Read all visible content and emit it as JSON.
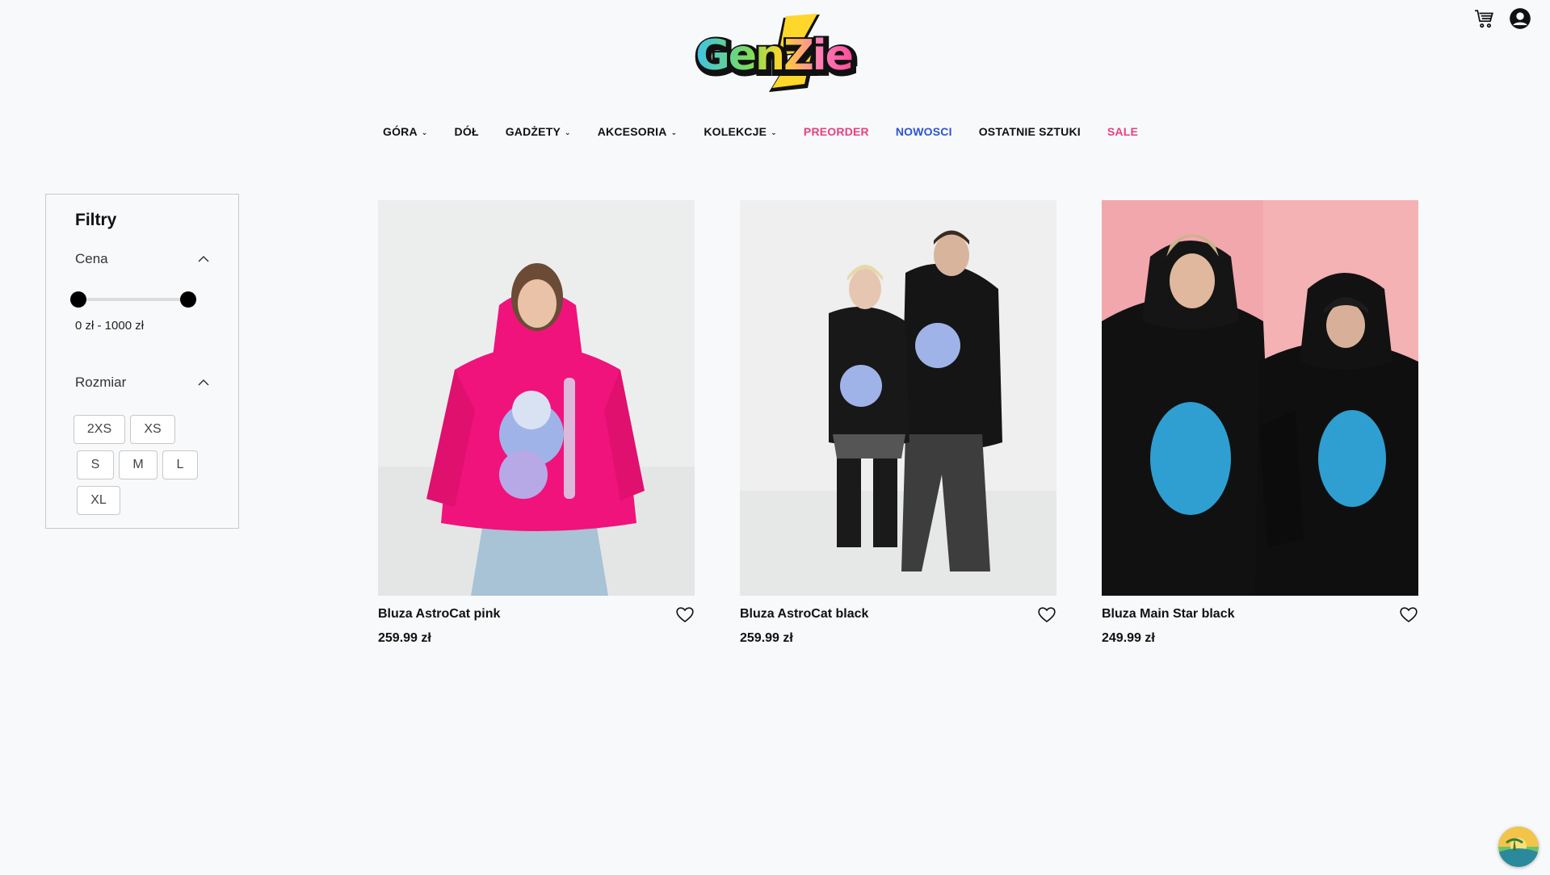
{
  "brand": {
    "logo_text": "GenZie"
  },
  "nav": [
    {
      "label": "GÓRA",
      "dropdown": true,
      "style": "default"
    },
    {
      "label": "DÓŁ",
      "dropdown": false,
      "style": "default"
    },
    {
      "label": "GADŻETY",
      "dropdown": true,
      "style": "default"
    },
    {
      "label": "AKCESORIA",
      "dropdown": true,
      "style": "default"
    },
    {
      "label": "KOLEKCJE",
      "dropdown": true,
      "style": "default"
    },
    {
      "label": "PREORDER",
      "dropdown": false,
      "style": "pink"
    },
    {
      "label": "NOWOSCI",
      "dropdown": false,
      "style": "blue"
    },
    {
      "label": "OSTATNIE SZTUKI",
      "dropdown": false,
      "style": "default"
    },
    {
      "label": "SALE",
      "dropdown": false,
      "style": "pink"
    }
  ],
  "filters": {
    "title": "Filtry",
    "price": {
      "label": "Cena",
      "range_label": "0 zł - 1000 zł",
      "min": 0,
      "max": 1000
    },
    "size": {
      "label": "Rozmiar",
      "options": [
        "2XS",
        "XS",
        "S",
        "M",
        "L",
        "XL"
      ]
    }
  },
  "products": [
    {
      "name": "Bluza AstroCat pink",
      "price": "259.99 zł"
    },
    {
      "name": "Bluza AstroCat black",
      "price": "259.99 zł"
    },
    {
      "name": "Bluza Main Star black",
      "price": "249.99 zł"
    }
  ],
  "colors": {
    "accent_pink": "#e9407f",
    "accent_blue": "#2b54d6",
    "background": "#f8f9fb"
  }
}
